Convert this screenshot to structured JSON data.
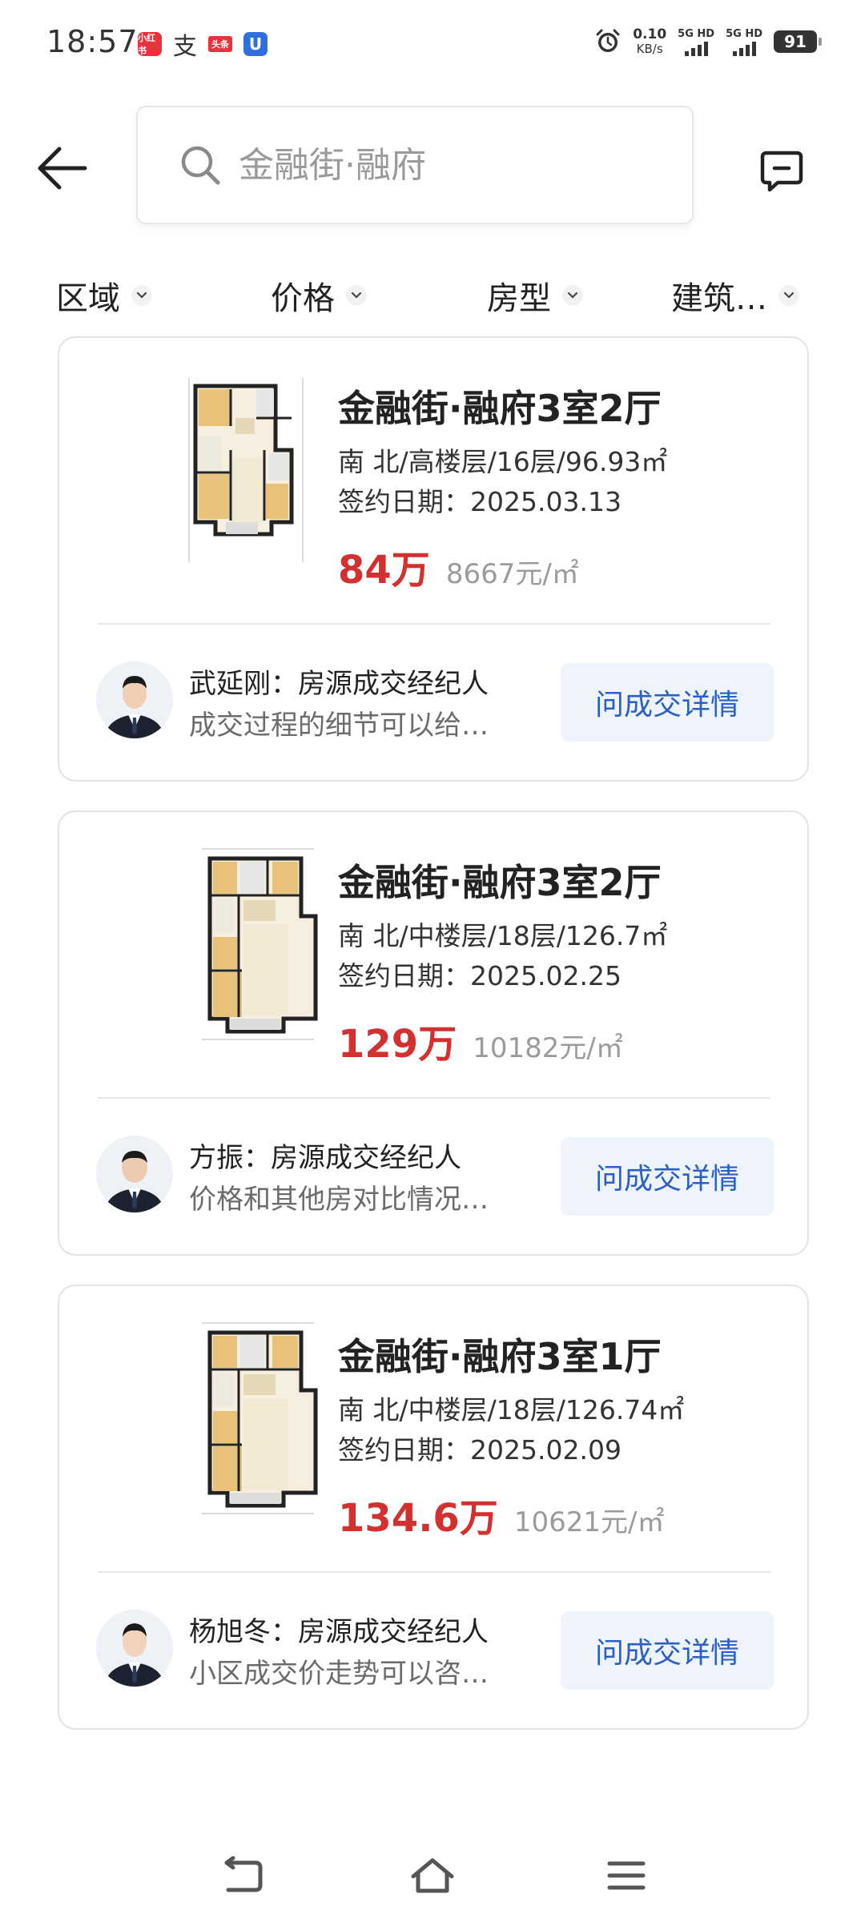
{
  "status_bar": {
    "time": "18:57",
    "app_icons": [
      {
        "icon": "xiaohongshu-icon",
        "label": "小红书"
      },
      {
        "icon": "alipay-icon",
        "label": "支"
      },
      {
        "icon": "toutiao-icon",
        "label": "头条"
      },
      {
        "icon": "blue-app-icon",
        "label": "U"
      }
    ],
    "net_speed": "0.10",
    "net_unit": "KB/s",
    "signal1": "5G HD",
    "signal2": "5G HD",
    "battery": "91"
  },
  "header": {
    "search_placeholder": "金融街·融府"
  },
  "filters": [
    {
      "label": "区域"
    },
    {
      "label": "价格"
    },
    {
      "label": "房型"
    },
    {
      "label": "建筑…"
    }
  ],
  "listings": [
    {
      "title": "金融街·融府3室2厅",
      "spec": "南 北/高楼层/16层/96.93㎡",
      "date": "签约日期：2025.03.13",
      "price_total": "84万",
      "price_unit": "8667元/㎡",
      "agent_name": "武延刚：房源成交经纪人",
      "agent_note": "成交过程的细节可以给…",
      "button": "问成交详情"
    },
    {
      "title": "金融街·融府3室2厅",
      "spec": "南 北/中楼层/18层/126.7㎡",
      "date": "签约日期：2025.02.25",
      "price_total": "129万",
      "price_unit": "10182元/㎡",
      "agent_name": "方振：房源成交经纪人",
      "agent_note": "价格和其他房对比情况…",
      "button": "问成交详情"
    },
    {
      "title": "金融街·融府3室1厅",
      "spec": "南 北/中楼层/18层/126.74㎡",
      "date": "签约日期：2025.02.09",
      "price_total": "134.6万",
      "price_unit": "10621元/㎡",
      "agent_name": "杨旭冬：房源成交经纪人",
      "agent_note": "小区成交价走势可以咨…",
      "button": "问成交详情"
    }
  ],
  "colors": {
    "price_red": "#d3312f",
    "button_blue": "#2a5fc4",
    "button_bg": "#eef3fc"
  }
}
